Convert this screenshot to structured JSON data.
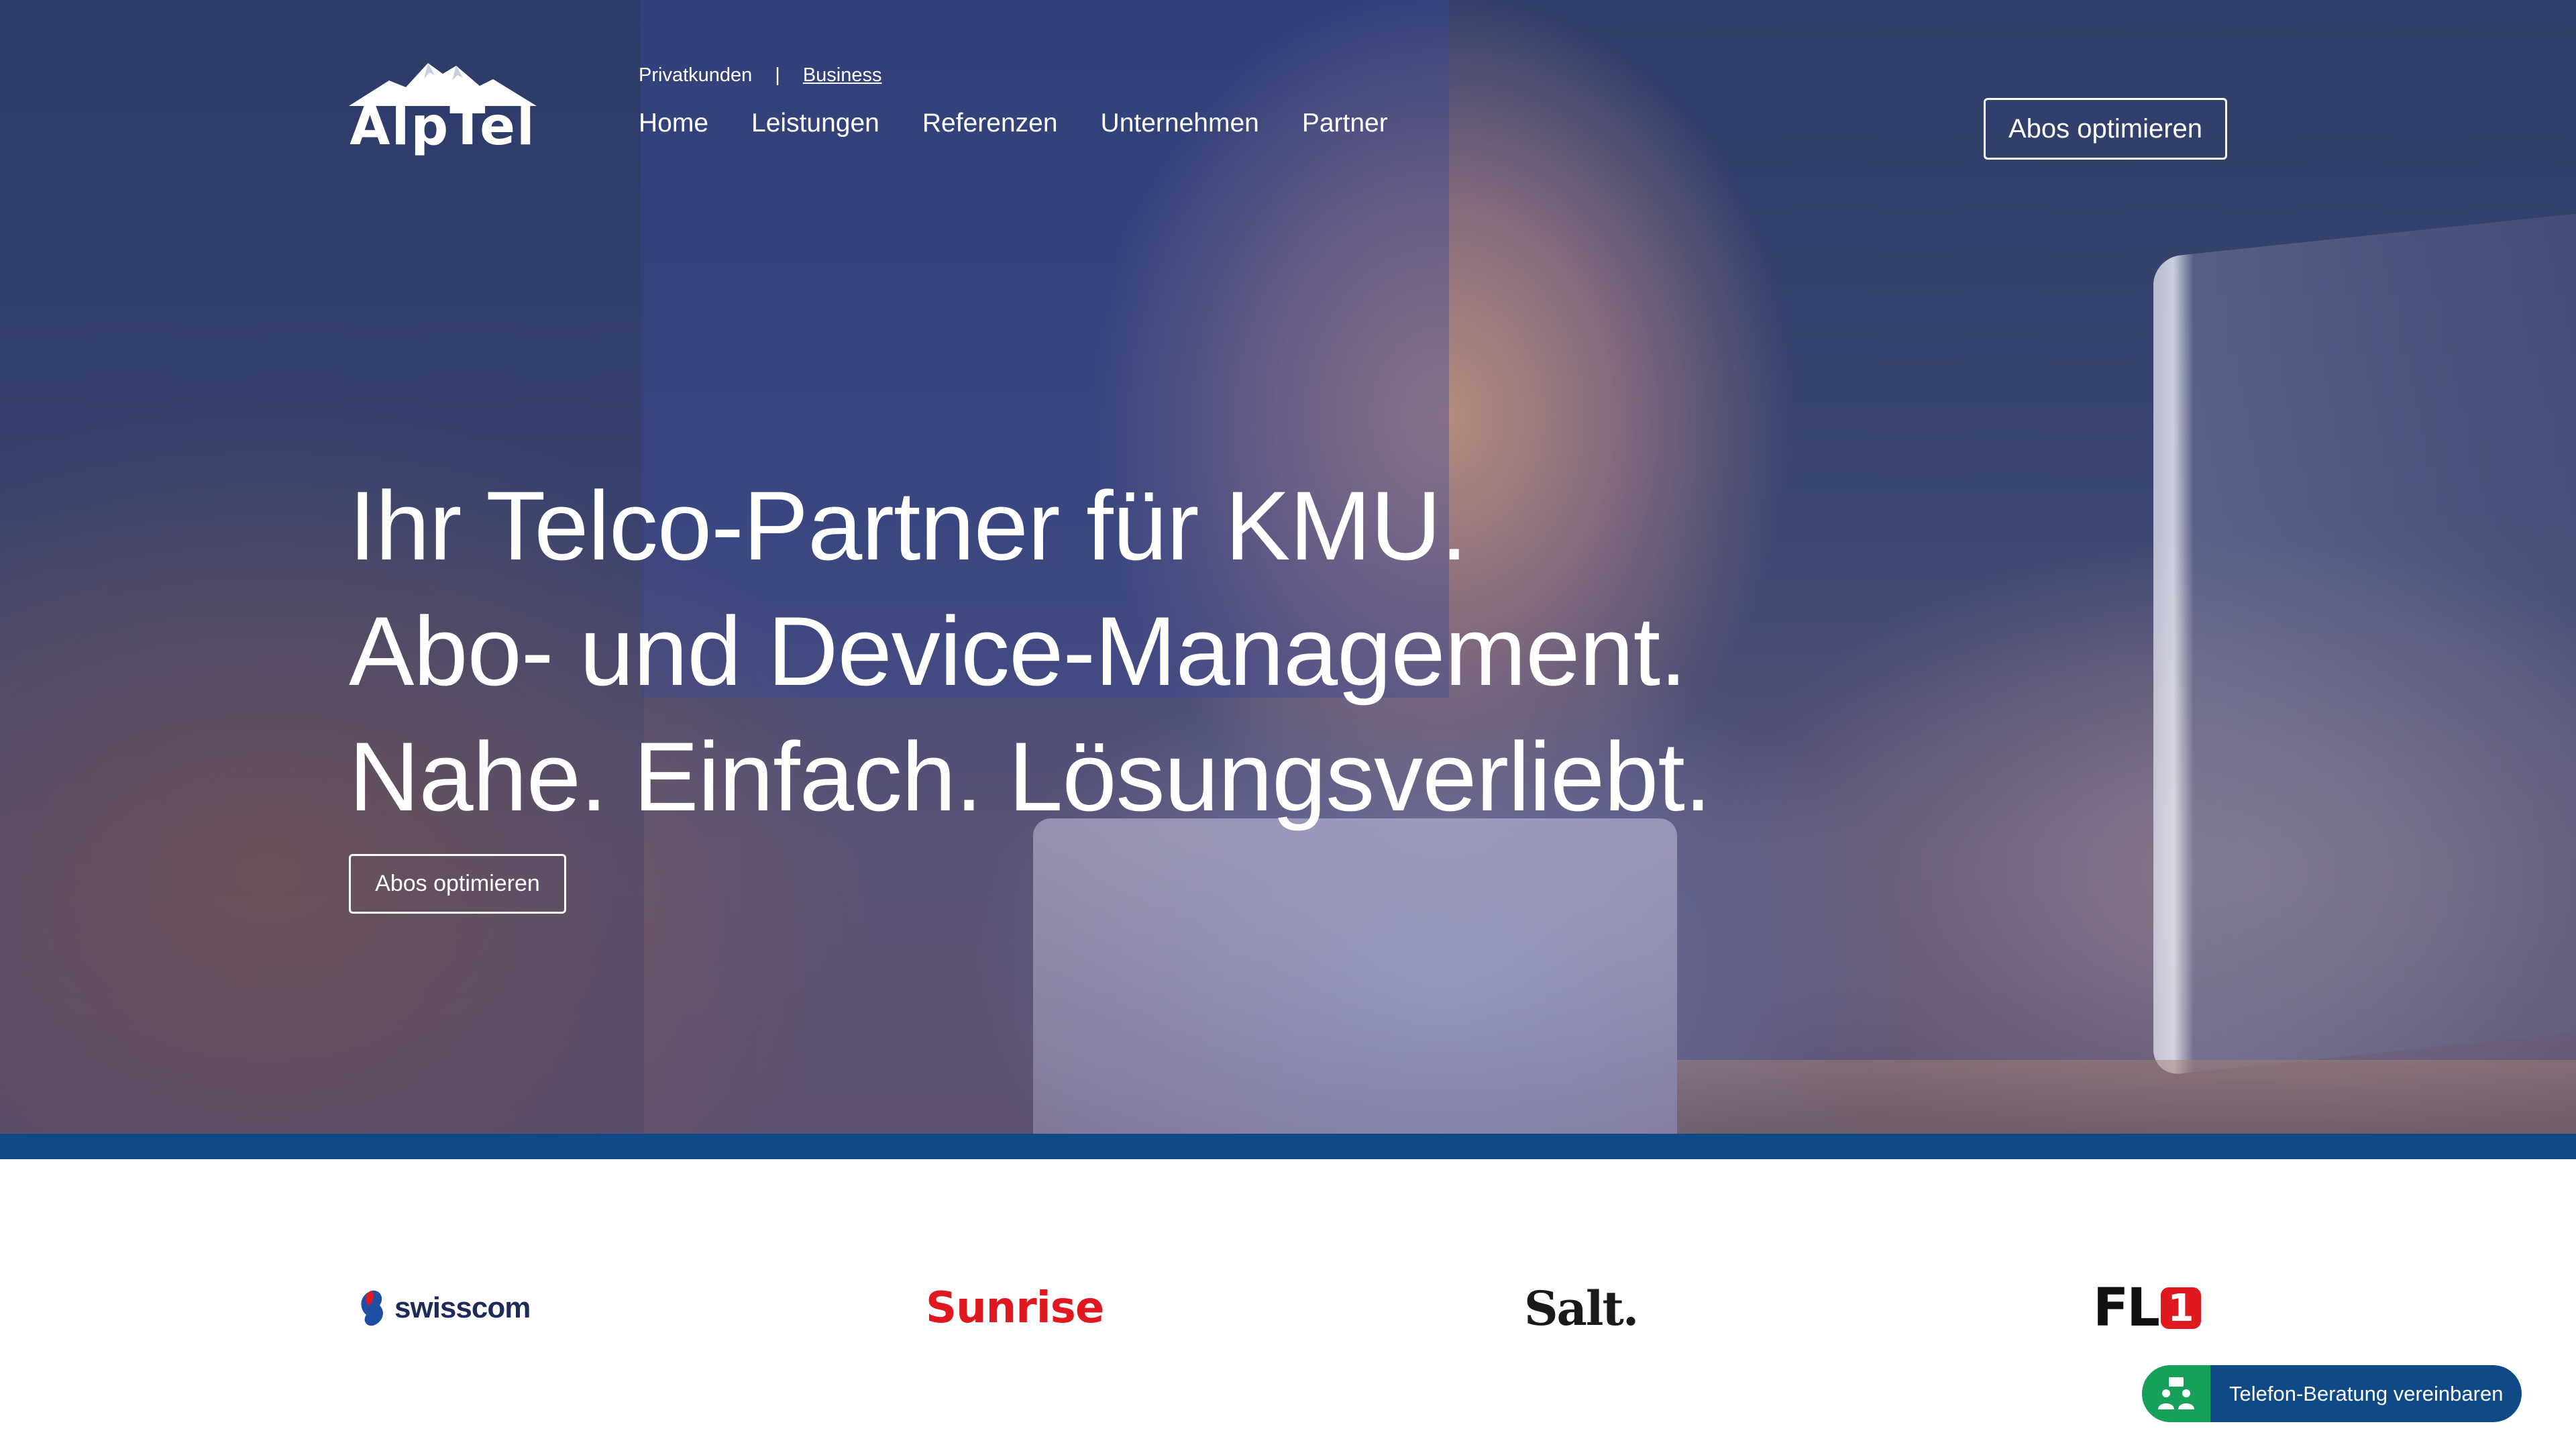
{
  "brand": {
    "name": "AlpTel"
  },
  "header": {
    "audience": {
      "private_label": "Privatkunden",
      "separator": "|",
      "business_label": "Business"
    },
    "nav": [
      {
        "label": "Home"
      },
      {
        "label": "Leistungen"
      },
      {
        "label": "Referenzen"
      },
      {
        "label": "Unternehmen"
      },
      {
        "label": "Partner"
      }
    ],
    "cta_label": "Abos optimieren"
  },
  "hero": {
    "lines": [
      "Ihr Telco-Partner für KMU.",
      "Abo- und Device-Management.",
      "Nahe. Einfach. Lösungsverliebt."
    ],
    "cta_label": "Abos optimieren"
  },
  "partners": [
    {
      "name": "swisscom"
    },
    {
      "name": "Sunrise"
    },
    {
      "name": "Salt."
    },
    {
      "name": "FL",
      "badge": "1"
    }
  ],
  "consult_button": {
    "label": "Telefon-Beratung vereinbaren",
    "icon": "people-icon"
  },
  "colors": {
    "band": "#0f4a86",
    "consult_bg": "#0f4a86",
    "consult_icon_bg": "#16a05a",
    "sunrise_red": "#e0181f",
    "swisscom_navy": "#1e2b5a"
  }
}
